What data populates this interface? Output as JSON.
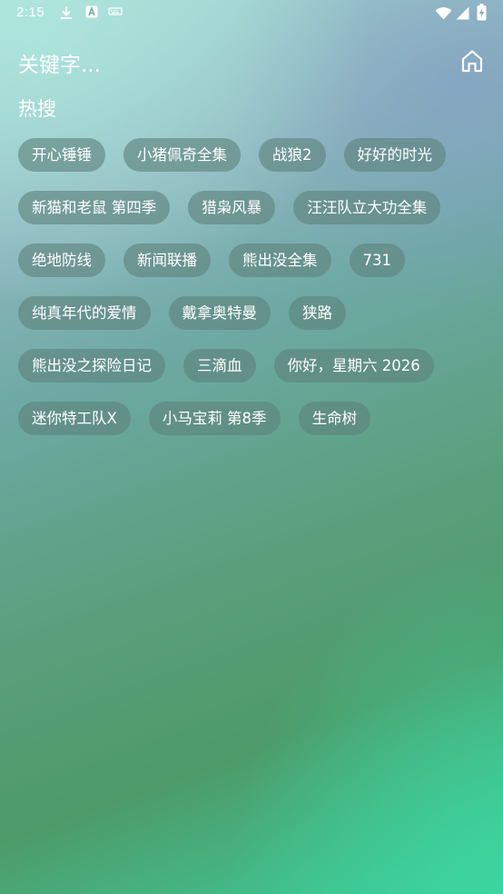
{
  "status_bar": {
    "time": "2:15",
    "left_icons": [
      "download-icon",
      "a-badge-icon",
      "keyboard-icon"
    ],
    "right_icons": [
      "wifi-icon",
      "cellular-signal-icon",
      "battery-charging-icon"
    ]
  },
  "header": {
    "search_hint": "关键字...",
    "home_icon": "home-icon"
  },
  "hot_search": {
    "title": "热搜",
    "tags": [
      "开心锤锤",
      "小猪佩奇全集",
      "战狼2",
      "好好的时光",
      "新猫和老鼠 第四季",
      "猎枭风暴",
      "汪汪队立大功全集",
      "绝地防线",
      "新闻联播",
      "熊出没全集",
      "731",
      "纯真年代的爱情",
      "戴拿奥特曼",
      "狭路",
      "熊出没之探险日记",
      "三滴血",
      "你好，星期六 2026",
      "迷你特工队X",
      "小马宝莉 第8季",
      "生命树"
    ]
  },
  "colors": {
    "tag_background": "#5e827c",
    "text": "#ffffff",
    "gradient_top": "#a9dfd6",
    "gradient_bottom": "#3ccf9c"
  }
}
